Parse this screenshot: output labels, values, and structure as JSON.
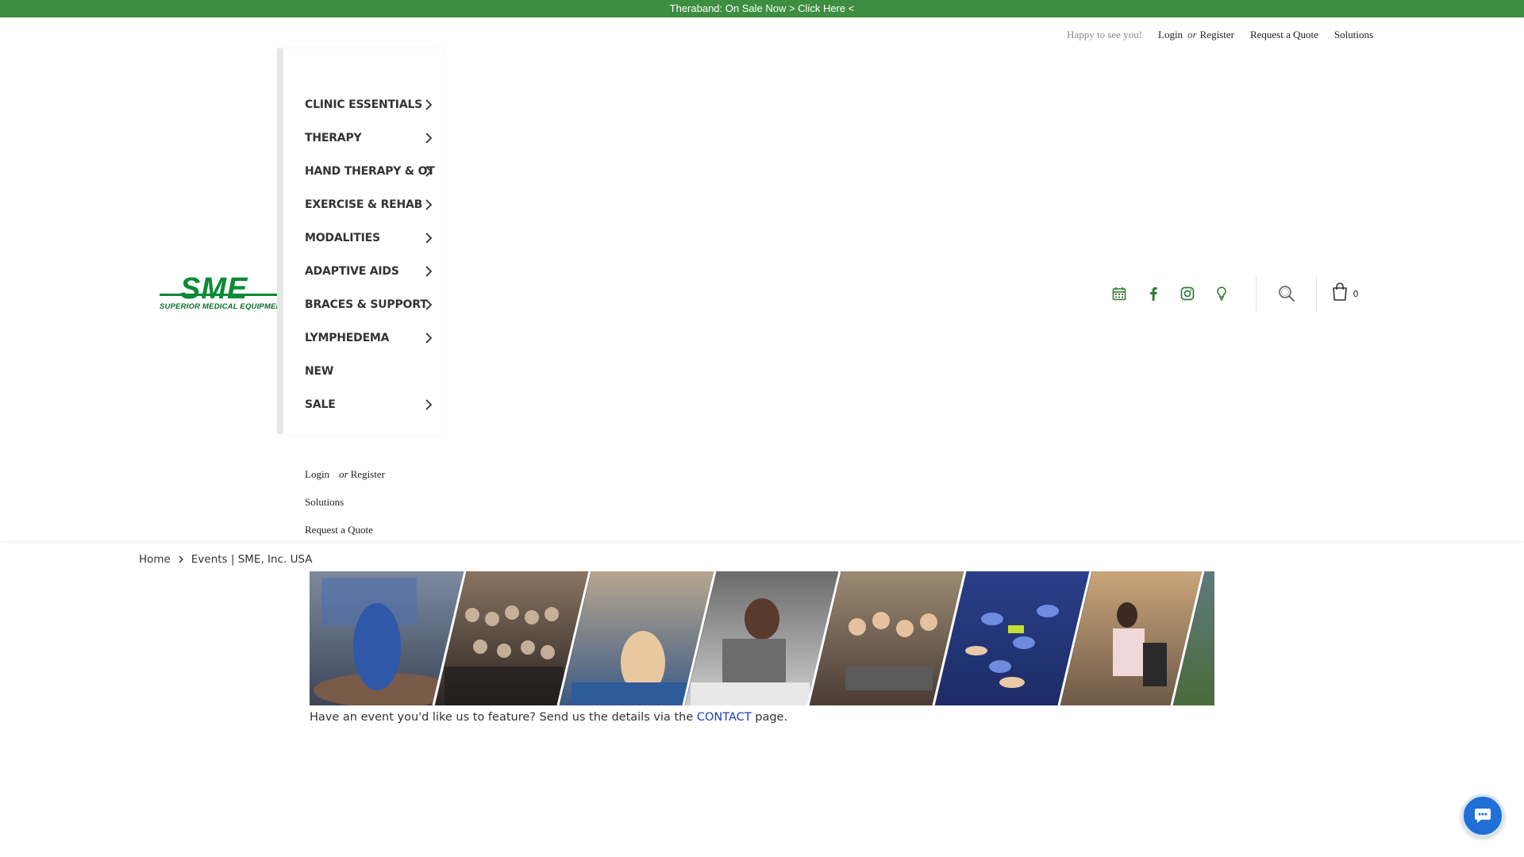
{
  "promo": {
    "text": "Theraband: On Sale Now > Click Here <"
  },
  "top_links": {
    "greeting": "Happy to see you!",
    "login": "Login",
    "or": "or",
    "register": "Register",
    "quote": "Request a Quote",
    "solutions": "Solutions"
  },
  "logo": {
    "wordmark": "SME",
    "tagline": "SUPERIOR MEDICAL EQUIPMENT"
  },
  "menu": {
    "items": [
      {
        "label": "CLINIC ESSENTIALS",
        "has_submenu": true
      },
      {
        "label": "THERAPY",
        "has_submenu": true
      },
      {
        "label": "HAND THERAPY & OT",
        "has_submenu": true
      },
      {
        "label": "EXERCISE & REHAB",
        "has_submenu": true
      },
      {
        "label": "MODALITIES",
        "has_submenu": true
      },
      {
        "label": "ADAPTIVE AIDS",
        "has_submenu": true
      },
      {
        "label": "BRACES & SUPPORT",
        "has_submenu": true
      },
      {
        "label": "LYMPHEDEMA",
        "has_submenu": true
      },
      {
        "label": "NEW",
        "has_submenu": false
      },
      {
        "label": "SALE",
        "has_submenu": true
      }
    ]
  },
  "menu_sub_links": {
    "login": "Login",
    "or": "or",
    "register": "Register",
    "solutions": "Solutions",
    "quote": "Request a Quote"
  },
  "header_icons": [
    "calendar-icon",
    "facebook-icon",
    "instagram-icon",
    "lightbulb-icon",
    "search-icon",
    "shopping-bag-icon"
  ],
  "cart": {
    "count": "0"
  },
  "breadcrumb": {
    "home": "Home",
    "current": "Events | SME, Inc. USA"
  },
  "event_text": {
    "before": "Have an event you'd like us to feature? Send us the details via the ",
    "link": "CONTACT",
    "after": " page."
  },
  "colors": {
    "promo_bg": "#3e8e41",
    "brand_green": "#0a8a35",
    "icon_green": "#2e7d32",
    "link_blue": "#1a3ec0",
    "chat_blue": "#1f6fd6"
  }
}
